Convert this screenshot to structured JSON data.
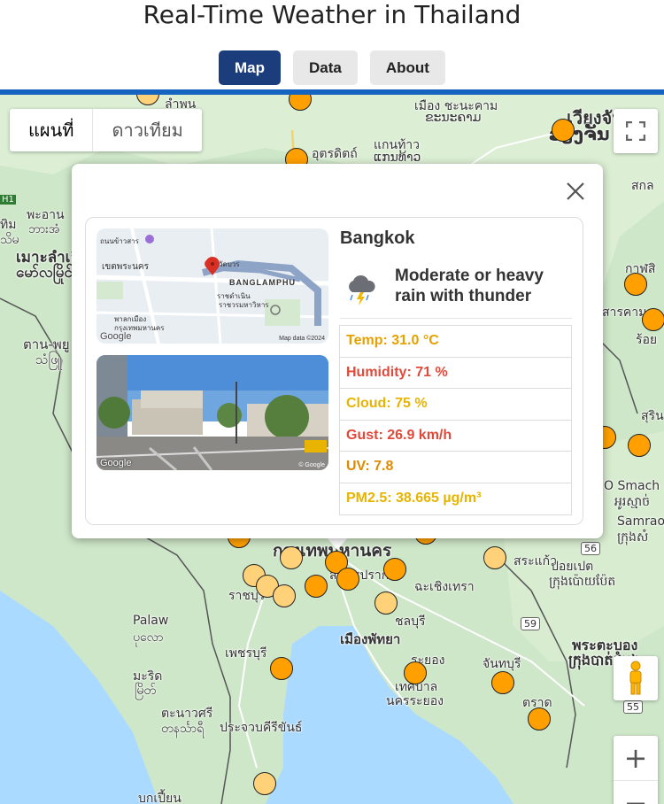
{
  "header": {
    "title": "Real-Time Weather in Thailand",
    "nav": [
      {
        "label": "Map",
        "active": true
      },
      {
        "label": "Data",
        "active": false
      },
      {
        "label": "About",
        "active": false
      }
    ]
  },
  "map": {
    "type_control": {
      "map_label": "แผนที่",
      "satellite_label": "ดาวเทียม"
    },
    "zoom_in": "+",
    "zoom_out": "−",
    "place_labels": {
      "lamphun": "ลำพน",
      "mueang_chiang_khan": "เมือง ชะนะคาม",
      "mueang_chiang_khan_lao": "ຂະນະຄາມ",
      "vientiane": "เวียงจัน",
      "vientiane_lao": "ວຽງຈັນ",
      "uttaradit": "อุตรดิตถ์",
      "khon_kaen": "แกนท้าว",
      "khon_kaen_lao": "ແກນທ້າວ",
      "phayao": "พะอาน",
      "phayao_burmese": "ဘားအံ",
      "moulmein": "เมาะลำเลิ",
      "moulmein_burmese": "မော်လမြိုင်",
      "tanyuan": "ตาน-พยู",
      "tanyuan_burmese": "သံဖြူ",
      "kalasin": "กาฬสิ",
      "sakon": "สกล",
      "sarakham": "สารคาม",
      "roiet": "ร้อย",
      "surin": "สุริน",
      "smach": "O Smach",
      "smach_khmer": "អូរស្មាច់",
      "samraong": "Samraon",
      "samraong_khmer": "ក្រុងសំ",
      "bangkok": "กรุงเทพมหานคร",
      "samutprakan": "สมุทรปราการ",
      "ratchaburi": "ราชบุรี",
      "chachoengsao": "ฉะเชิงเทรา",
      "sakaeo": "สระแก้ว",
      "poipet": "ปอยเปต",
      "poipet_khmer": "ក្រុងប៉ោយប៉ែត",
      "palaw": "Palaw",
      "palaw_burmese": "ပုလော",
      "chonburi": "ชลบุรี",
      "pattaya": "เมืองพัทยา",
      "battambang": "พระตะบอง",
      "battambang_khmer": "ក្រុងបាត់ដំបង",
      "phetchaburi": "เพชรบุรี",
      "rayong": "ระยอง",
      "chanthaburi": "จันทบุรี",
      "rayong_city": "เทศบาล",
      "rayong_city2": "นครระยอง",
      "mergui": "มะริด",
      "mergui_burmese": "မြိတ်",
      "tenasserim": "ตะนาวศรี",
      "tenasserim_burmese": "တနင်္သာရီ",
      "prachuap": "ประจวบคีรีขันธ์",
      "trat": "ตราด",
      "bokpyin": "บกเปี้ยน",
      "route56": "56",
      "route59": "59",
      "route55": "55",
      "h1": "H1",
      "thimphu": "ทิม",
      "thimphu_b": "သိမ"
    }
  },
  "popup": {
    "city": "Bangkok",
    "condition": "Moderate or heavy rain with thunder",
    "condition_icon": "thunder-rain-icon",
    "stats": [
      {
        "text": "Temp: 31.0 °C",
        "color": "#e6a100"
      },
      {
        "text": "Humidity: 71 %",
        "color": "#e04a3a"
      },
      {
        "text": "Cloud: 75 %",
        "color": "#e8b400"
      },
      {
        "text": "Gust: 26.9 km/h",
        "color": "#e04a3a"
      },
      {
        "text": "UV: 7.8",
        "color": "#e08a00"
      },
      {
        "text": "PM2.5: 38.665 µg/m³",
        "color": "#e8b400"
      }
    ],
    "map_thumb": {
      "labels": {
        "road1": "ถนนข้าวสาร",
        "district": "เขตพระนคร",
        "area": "BANGLAMPHU",
        "mosque": "มัสยิด",
        "district2": "ราชดำเนิน",
        "museum": "พาลกเมือง",
        "museum2": "กรุงเทพมหานคร",
        "temple": "วัดบวร",
        "map_data": "Map data ©2024",
        "google": "Google",
        "bangkok_city": "ราชวรมหาวิหาร"
      }
    },
    "street_thumb": {
      "google": "Google",
      "copyright": "© Google"
    }
  }
}
